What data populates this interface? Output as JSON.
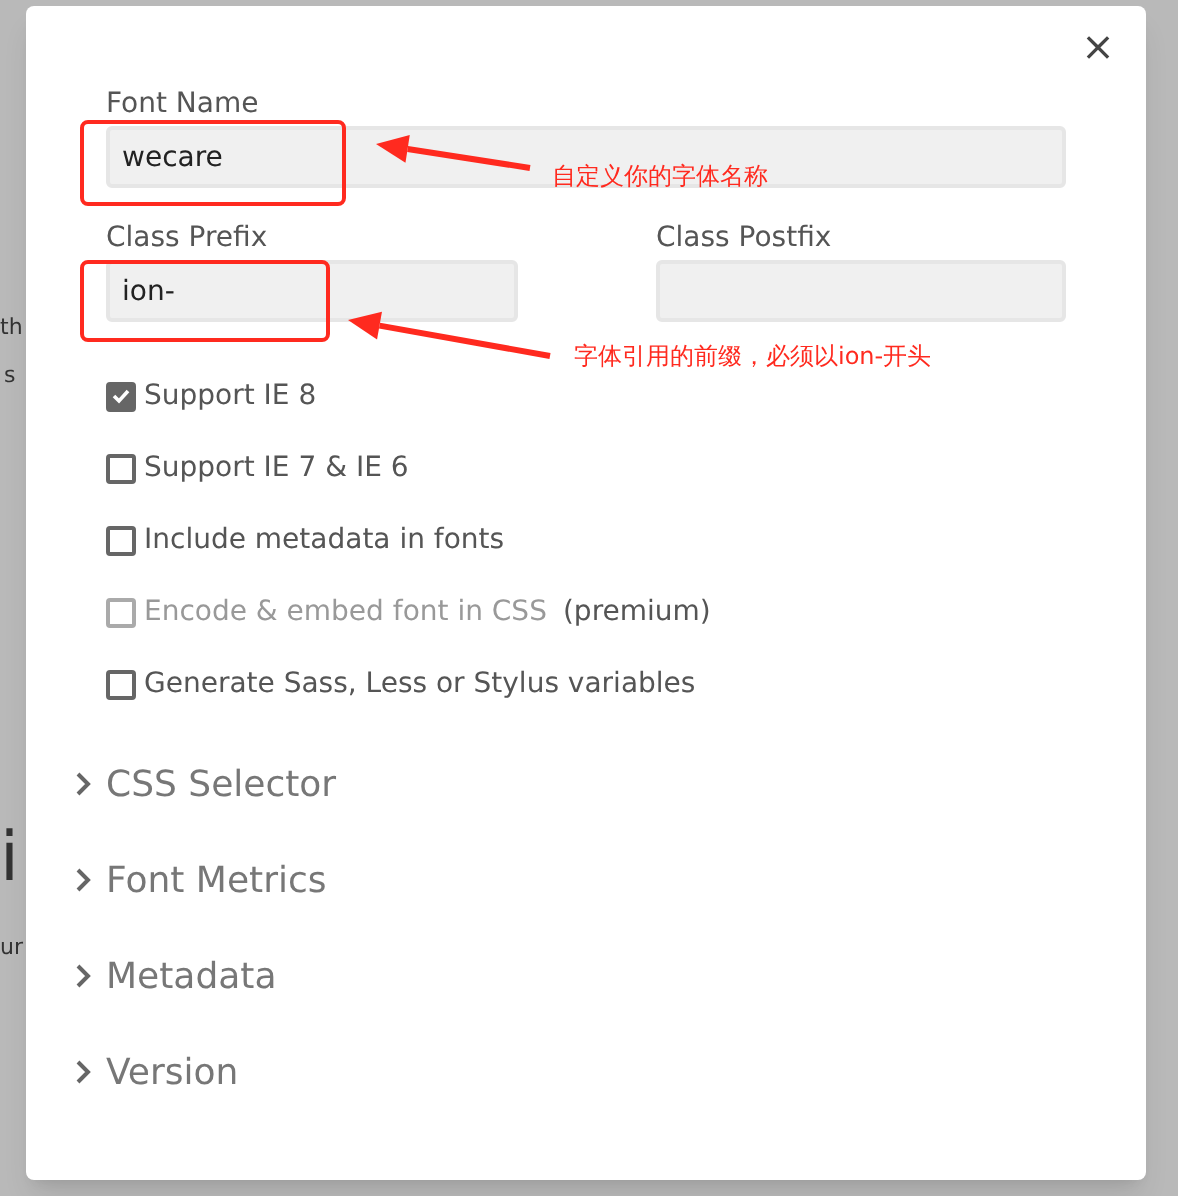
{
  "background": {
    "fragments": [
      {
        "text": "th",
        "kind": "small"
      },
      {
        "text": "s",
        "kind": "small"
      },
      {
        "text": "i",
        "kind": "large"
      },
      {
        "text": "ur",
        "kind": "small"
      }
    ]
  },
  "dialog": {
    "close": "×",
    "font_name": {
      "label": "Font Name",
      "value": "wecare"
    },
    "class_prefix": {
      "label": "Class Prefix",
      "value": "ion-"
    },
    "class_postfix": {
      "label": "Class Postfix"
    },
    "options": [
      {
        "label": "Support IE 8",
        "checked": true,
        "disabled": false
      },
      {
        "label": "Support IE 7 & IE 6",
        "checked": false,
        "disabled": false
      },
      {
        "label": "Include metadata in fonts",
        "checked": false,
        "disabled": false
      },
      {
        "label": "Encode & embed font in CSS",
        "note": "(premium)",
        "checked": false,
        "disabled": true
      },
      {
        "label": "Generate Sass, Less or Stylus variables",
        "checked": false,
        "disabled": false
      }
    ],
    "sections": [
      {
        "label": "CSS Selector",
        "expanded": false
      },
      {
        "label": "Font Metrics",
        "expanded": false
      },
      {
        "label": "Metadata",
        "expanded": false
      },
      {
        "label": "Version",
        "expanded": false
      }
    ]
  },
  "annotations": [
    "自定义你的字体名称",
    "字体引用的前缀，必须以ion-开头"
  ]
}
